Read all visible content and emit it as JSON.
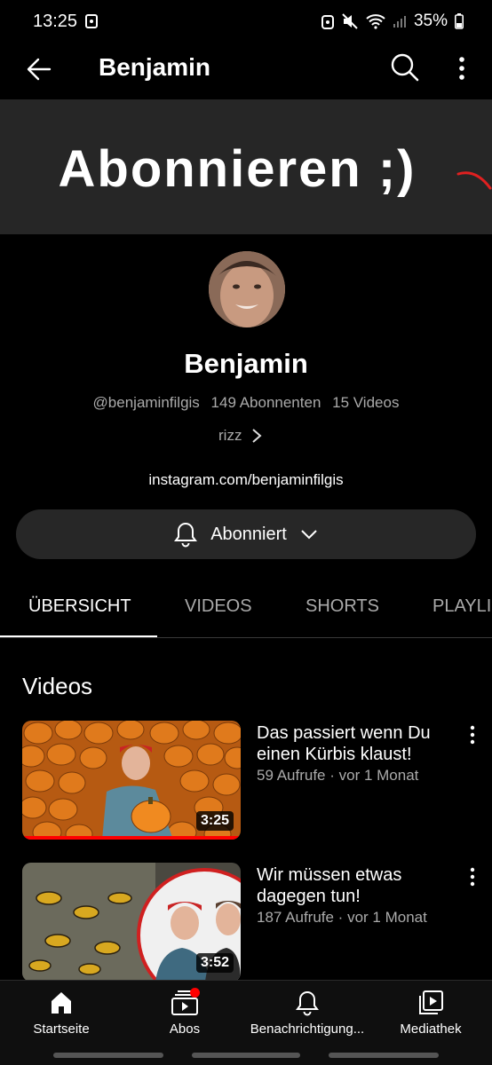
{
  "status": {
    "time": "13:25",
    "battery": "35%"
  },
  "header": {
    "title": "Benjamin"
  },
  "banner": {
    "text": "Abonnieren ;)"
  },
  "channel": {
    "name": "Benjamin",
    "handle": "@benjaminfilgis",
    "subscribers": "149 Abonnenten",
    "videos": "15 Videos",
    "description": "rizz",
    "link": "instagram.com/benjaminfilgis",
    "subscribe_label": "Abonniert"
  },
  "tabs": [
    {
      "label": "ÜBERSICHT"
    },
    {
      "label": "VIDEOS"
    },
    {
      "label": "SHORTS"
    },
    {
      "label": "PLAYLISTS"
    }
  ],
  "section": {
    "title": "Videos"
  },
  "videos": [
    {
      "title": "Das passiert wenn Du einen Kürbis klaust!",
      "meta": "59 Aufrufe · vor 1 Monat",
      "duration": "3:25",
      "progress": 1.0
    },
    {
      "title": "Wir müssen etwas dagegen tun!",
      "meta": "187 Aufrufe · vor 1 Monat",
      "duration": "3:52",
      "progress": 0
    }
  ],
  "bottom_nav": [
    {
      "label": "Startseite",
      "icon": "home-icon"
    },
    {
      "label": "Abos",
      "icon": "subscriptions-icon"
    },
    {
      "label": "Benachrichtigung...",
      "icon": "bell-icon"
    },
    {
      "label": "Mediathek",
      "icon": "library-icon"
    }
  ],
  "colors": {
    "background": "#000000",
    "accent": "#ff0000",
    "secondary_text": "#aaaaaa"
  }
}
